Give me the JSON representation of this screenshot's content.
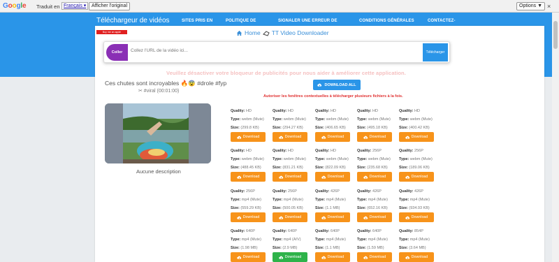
{
  "translate_bar": {
    "logo": "Google",
    "translated_to": "Traduit en :",
    "language": "Français",
    "show_original": "Afficher l'original",
    "options": "Options ▼",
    "close": "×"
  },
  "header": {
    "brand": "Téléchargeur de vidéos",
    "nav": [
      "SITES PRIS EN",
      "POLITIQUE DE",
      "SIGNALER UNE ERREUR DE",
      "CONDITIONS GÉNÉRALES",
      "CONTACTEZ-"
    ]
  },
  "support_badge": "Buy me an apple",
  "breadcrumb": {
    "home": "Home",
    "current": "TT Video Downloader"
  },
  "url_box": {
    "paste": "Coller",
    "placeholder": "Collez l'URL de la vidéo ici...",
    "download": "Télécharger"
  },
  "adblock_message": "Veuillez désactiver votre bloqueur de publicités pour nous aider à améliorer cette application.",
  "download_all": "DOWNLOAD ALL",
  "popups_message": "Autoriser les fenêtres contextuelles à télécharger plusieurs fichiers à la fois.",
  "video": {
    "title": "Ces chutes sont incroyables 🔥😨 #drole #fyp",
    "subtitle": "✂ #viral (00:01:00)",
    "description": "Aucune description"
  },
  "labels": {
    "quality": "Quality:",
    "type": "Type:",
    "size": "Size:",
    "button": "Download"
  },
  "formats": [
    [
      {
        "quality": "HD",
        "type": "webm (Mute)",
        "size": "(299.8 KB)",
        "button": "orange"
      },
      {
        "quality": "HD",
        "type": "webm (Mute)",
        "size": "(294.27 KB)",
        "button": "orange"
      },
      {
        "quality": "HD",
        "type": "webm (Mute)",
        "size": "(406.65 KB)",
        "button": "orange"
      },
      {
        "quality": "HD",
        "type": "webm (Mute)",
        "size": "(495.18 KB)",
        "button": "orange"
      },
      {
        "quality": "HD",
        "type": "webm (Mute)",
        "size": "(400.42 KB)",
        "button": "orange"
      }
    ],
    [
      {
        "quality": "HD",
        "type": "webm (Mute)",
        "size": "(488.45 KB)",
        "button": "orange"
      },
      {
        "quality": "HD",
        "type": "webm (Mute)",
        "size": "(831.21 KB)",
        "button": "orange"
      },
      {
        "quality": "HD",
        "type": "webm (Mute)",
        "size": "(822.09 KB)",
        "button": "orange"
      },
      {
        "quality": "256P",
        "type": "webm (Mute)",
        "size": "(235.68 KB)",
        "button": "orange"
      },
      {
        "quality": "256P",
        "type": "webm (Mute)",
        "size": "(189.06 KB)",
        "button": "orange"
      }
    ],
    [
      {
        "quality": "256P",
        "type": "mp4 (Mute)",
        "size": "(559.29 KB)",
        "button": "orange"
      },
      {
        "quality": "256P",
        "type": "mp4 (Mute)",
        "size": "(500.05 KB)",
        "button": "orange"
      },
      {
        "quality": "426P",
        "type": "mp4 (Mute)",
        "size": "(1.1 MB)",
        "button": "orange"
      },
      {
        "quality": "426P",
        "type": "mp4 (Mute)",
        "size": "(652.16 KB)",
        "button": "orange"
      },
      {
        "quality": "426P",
        "type": "mp4 (Mute)",
        "size": "(934.93 KB)",
        "button": "orange"
      }
    ],
    [
      {
        "quality": "640P",
        "type": "mp4 (Mute)",
        "size": "(1.98 MB)",
        "button": "orange"
      },
      {
        "quality": "640P",
        "type": "mp4 (A/V)",
        "size": "(2.9 MB)",
        "button": "green"
      },
      {
        "quality": "640P",
        "type": "mp4 (Mute)",
        "size": "(1.1 MB)",
        "button": "orange"
      },
      {
        "quality": "640P",
        "type": "mp4 (Mute)",
        "size": "(1.59 MB)",
        "button": "orange"
      },
      {
        "quality": "854P",
        "type": "mp4 (Mute)",
        "size": "(3.64 MB)",
        "button": "orange"
      }
    ]
  ],
  "colors": {
    "header": "#2a95e8",
    "paste": "#8a2fb5",
    "download_orange": "#f7931a",
    "download_green": "#2eb34a",
    "warning_red": "#e03030"
  }
}
